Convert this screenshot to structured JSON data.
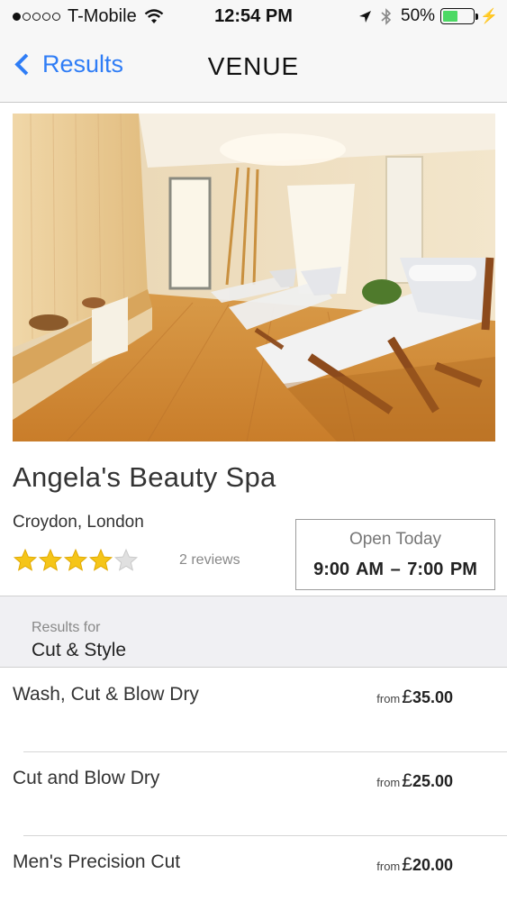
{
  "status_bar": {
    "carrier": "T-Mobile",
    "time": "12:54 PM",
    "battery": "50%",
    "battery_level": 0.5,
    "signal_bars": 1,
    "icons": [
      "signal-dots-icon",
      "wifi-icon",
      "location-arrow-icon",
      "bluetooth-icon",
      "battery-icon",
      "charging-bolt-icon"
    ]
  },
  "nav": {
    "back_label": "Results",
    "title": "VENUE"
  },
  "hero": {
    "alt": "spa relaxation room with lounge chairs"
  },
  "venue": {
    "name": "Angela's Beauty Spa",
    "location": "Croydon, London",
    "rating": 4,
    "rating_max": 5,
    "reviews": "2 reviews",
    "hours_label": "Open Today",
    "hours_time": "9:00 AM  –  7:00 PM"
  },
  "results": {
    "for_label": "Results for",
    "category": "Cut & Style"
  },
  "services": [
    {
      "name": "Wash, Cut & Blow Dry",
      "from": "from",
      "currency": "£",
      "price": "35.00"
    },
    {
      "name": "Cut and Blow Dry",
      "from": "from",
      "currency": "£",
      "price": "25.00"
    },
    {
      "name": "Men's Precision Cut",
      "from": "from",
      "currency": "£",
      "price": "20.00"
    }
  ],
  "colors": {
    "accent": "#2f7df6",
    "star": "#f5c518",
    "star_empty": "#e0e0e0",
    "battery": "#4cd964"
  }
}
